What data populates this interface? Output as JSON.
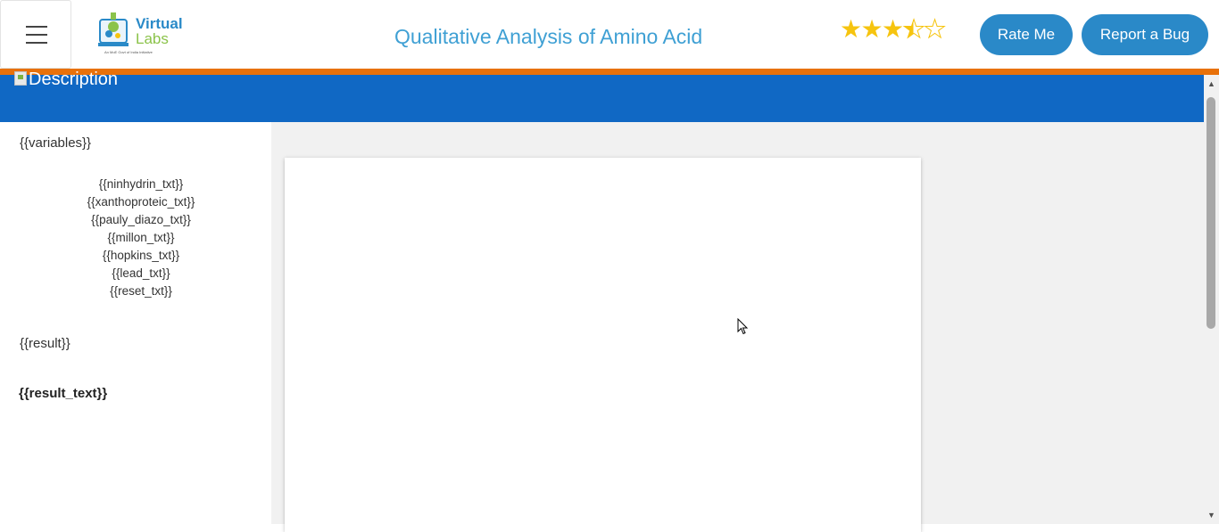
{
  "header": {
    "menu_icon": "hamburger-icon",
    "logo": {
      "word1": "Virtual",
      "word2": "Labs",
      "tagline": "An MoE Govt of India Initiative"
    },
    "title": "Qualitative Analysis of Amino Acid",
    "rating": {
      "value": 3.5,
      "max": 5
    },
    "rate_button": "Rate Me",
    "bug_button": "Report a Bug"
  },
  "banner": {
    "image_alt": "Description"
  },
  "sidebar": {
    "variables_heading": "{{variables}}",
    "variables": [
      "{{ninhydrin_txt}}",
      "{{xanthoproteic_txt}}",
      "{{pauly_diazo_txt}}",
      "{{millon_txt}}",
      "{{hopkins_txt}}",
      "{{lead_txt}}",
      "{{reset_txt}}"
    ],
    "result_heading": "{{result}}",
    "result_text": "{{result_text}}"
  },
  "colors": {
    "accent_blue": "#1068c4",
    "button_blue": "#2a89c8",
    "orange_bar": "#e8710a",
    "title_blue": "#3fa0d4",
    "star_yellow": "#f6c40f"
  }
}
